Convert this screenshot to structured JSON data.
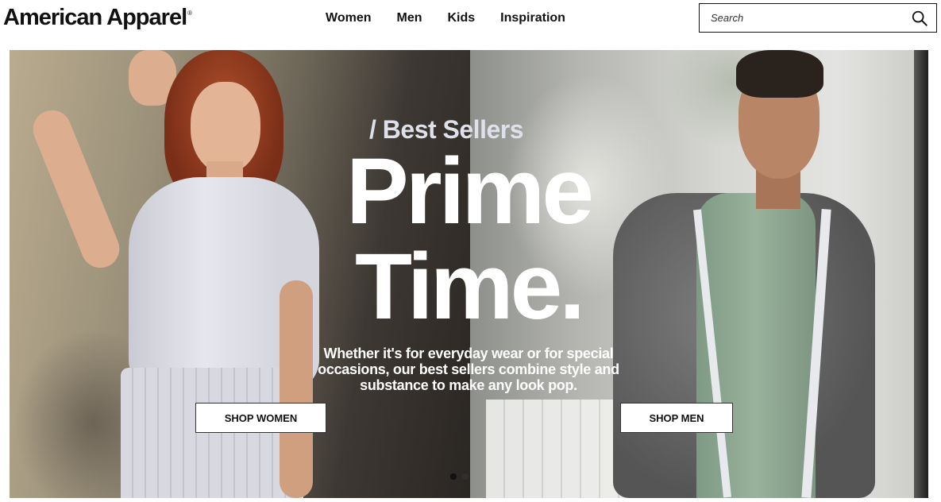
{
  "header": {
    "logo": "American Apparel",
    "logo_mark": "®",
    "nav": [
      "Women",
      "Men",
      "Kids",
      "Inspiration"
    ],
    "search": {
      "placeholder": "Search",
      "value": ""
    }
  },
  "hero": {
    "eyebrow": "/ Best Sellers",
    "headline": "Prime\nTime.",
    "description": "Whether it's for everyday wear or for special occasions, our best sellers combine style and substance to make any look pop.",
    "buttons": {
      "women": "SHOP WOMEN",
      "men": "SHOP MEN"
    },
    "carousel": {
      "slides": 2,
      "active": 1
    }
  },
  "icons": {
    "search": "search-icon"
  },
  "colors": {
    "text": "#111111",
    "eyebrow": "#dfe1ea",
    "button_bg": "#ffffff"
  }
}
